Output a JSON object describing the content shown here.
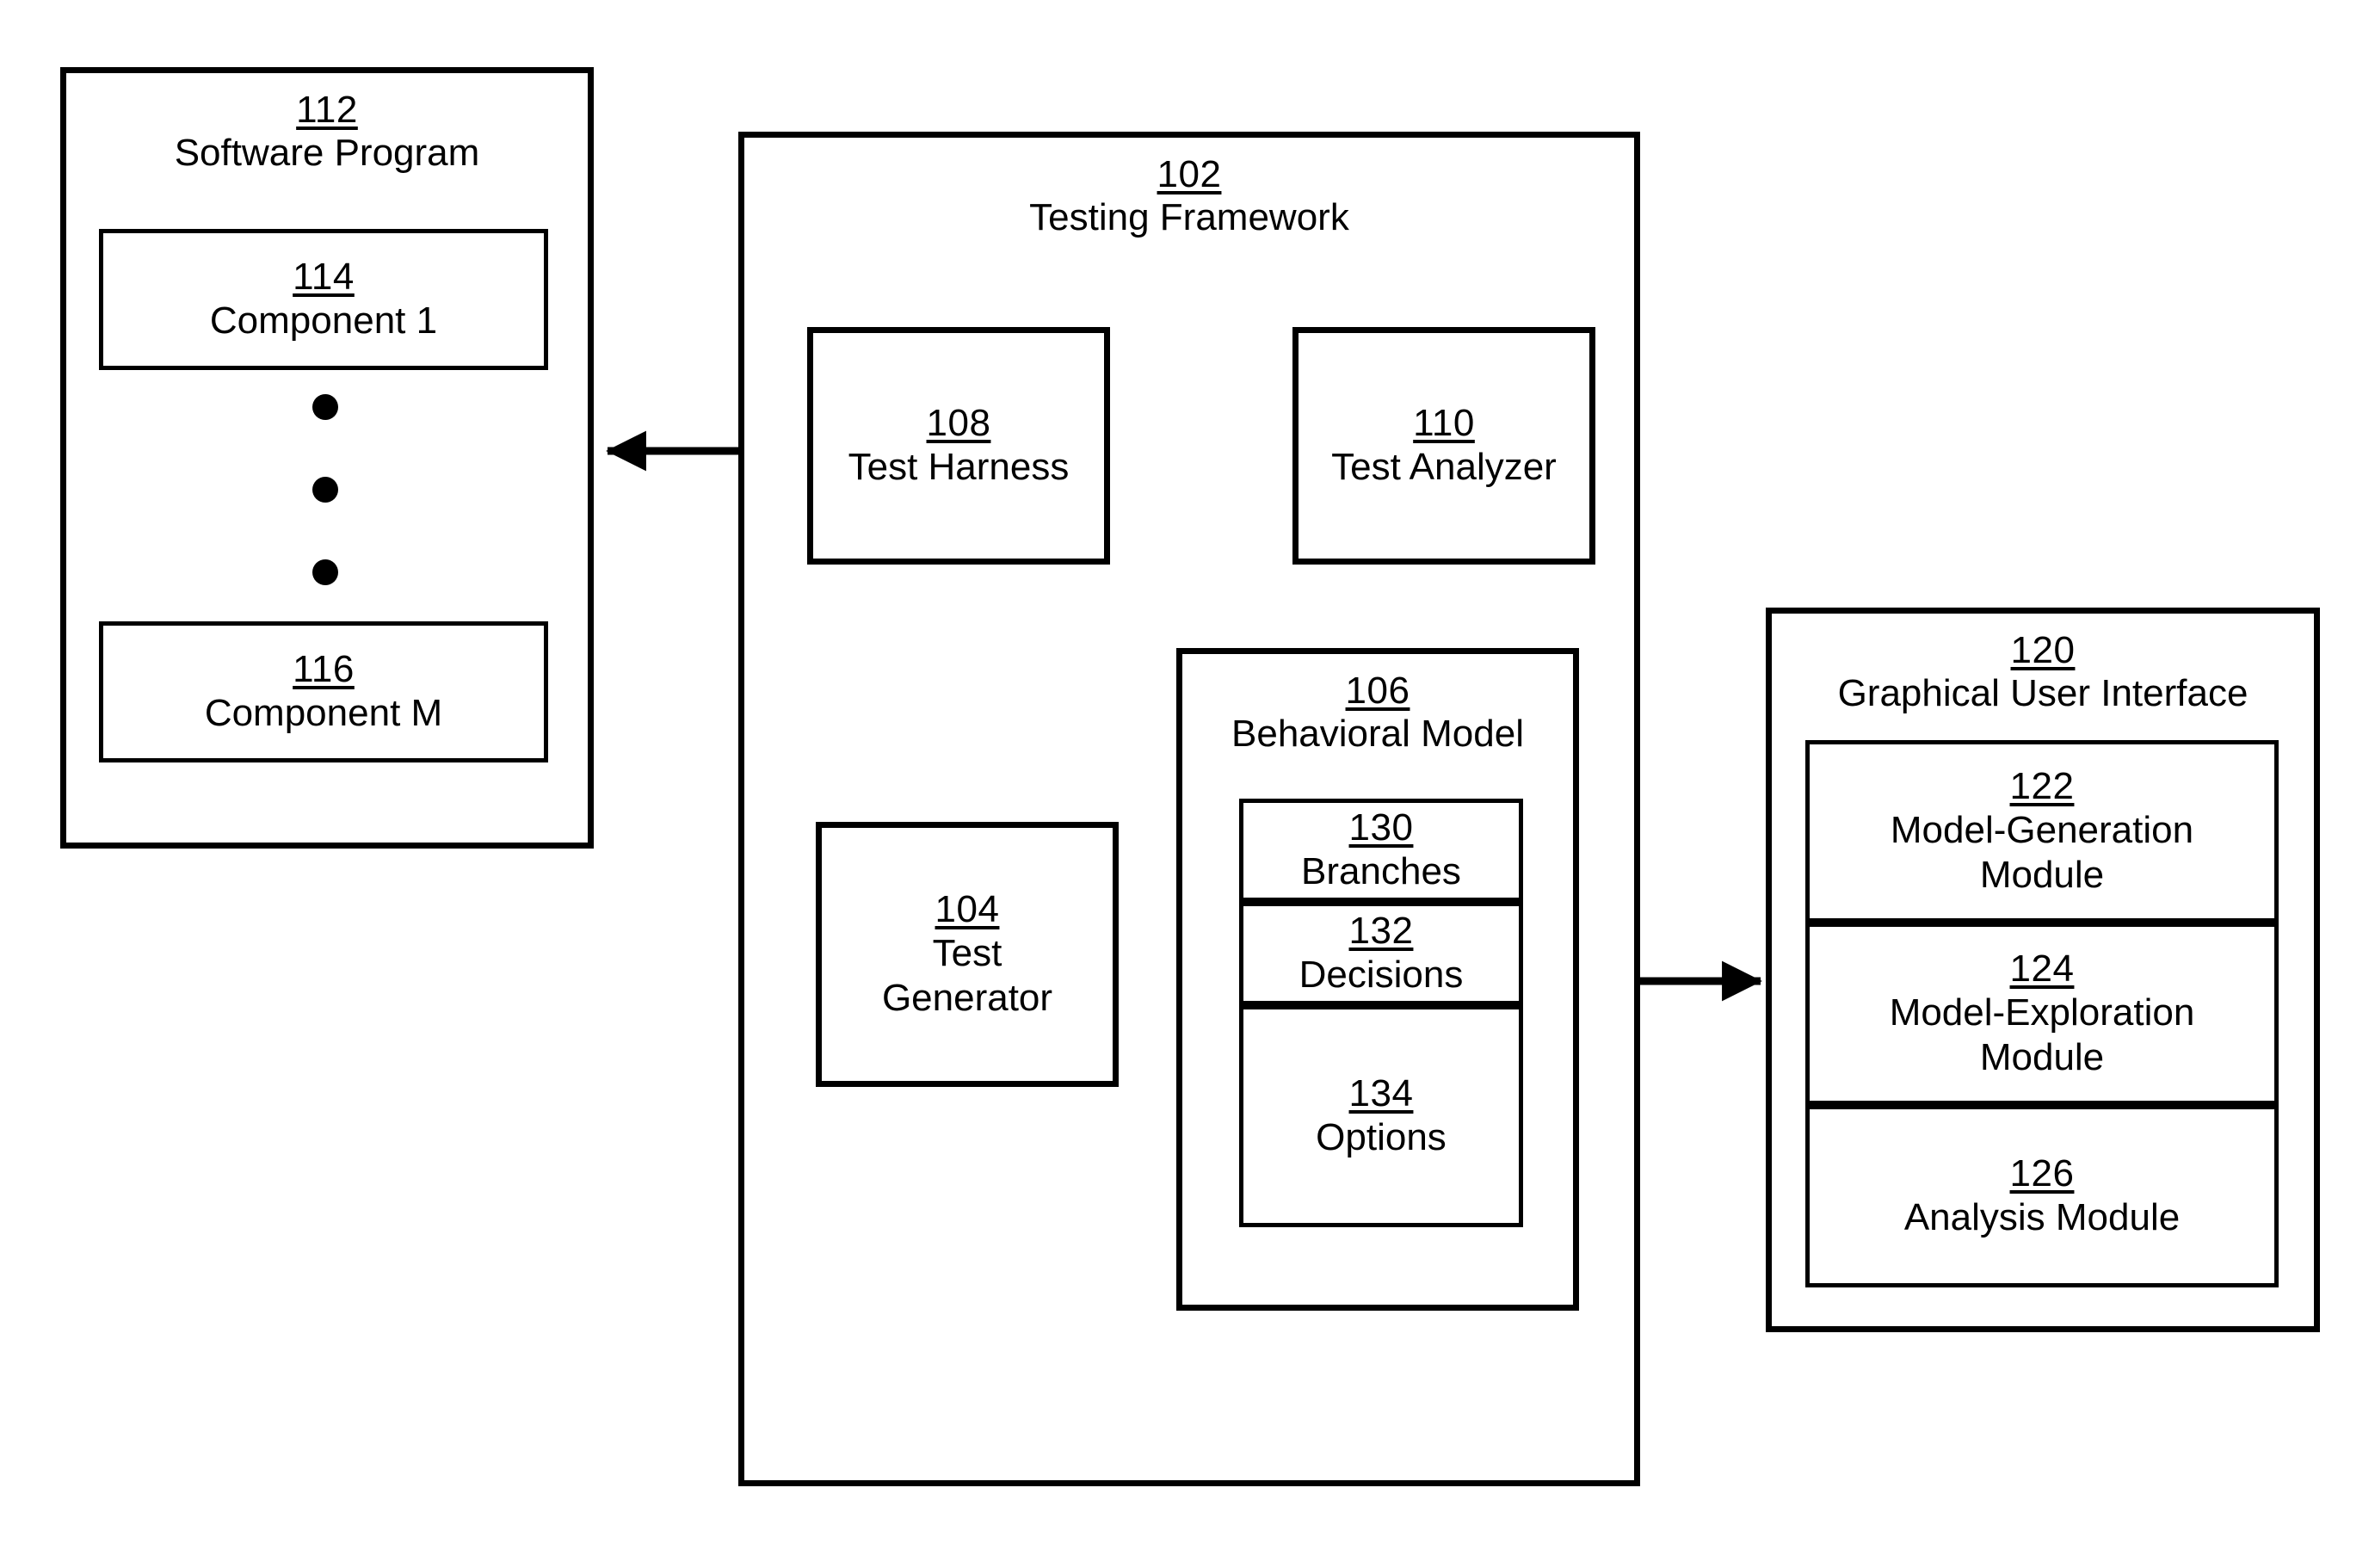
{
  "figure": {
    "kind": "patent-block-diagram",
    "stroke_color": "#000000",
    "background_color": "#ffffff"
  },
  "blocks": {
    "software_program": {
      "ref": "112",
      "label": "Software Program"
    },
    "component_1": {
      "ref": "114",
      "label": "Component 1"
    },
    "component_m": {
      "ref": "116",
      "label": "Component M"
    },
    "testing_framework": {
      "ref": "102",
      "label": "Testing Framework"
    },
    "test_harness": {
      "ref": "108",
      "label": "Test Harness"
    },
    "test_analyzer": {
      "ref": "110",
      "label": "Test Analyzer"
    },
    "test_generator": {
      "ref": "104",
      "label": "Test\nGenerator"
    },
    "behavioral_model": {
      "ref": "106",
      "label": "Behavioral Model"
    },
    "branches": {
      "ref": "130",
      "label": "Branches"
    },
    "decisions": {
      "ref": "132",
      "label": "Decisions"
    },
    "options": {
      "ref": "134",
      "label": "Options"
    },
    "gui": {
      "ref": "120",
      "label": "Graphical User Interface"
    },
    "model_generation": {
      "ref": "122",
      "label": "Model-Generation\nModule"
    },
    "model_exploration": {
      "ref": "124",
      "label": "Model-Exploration\nModule"
    },
    "analysis_module": {
      "ref": "126",
      "label": "Analysis Module"
    }
  },
  "ellipsis": {
    "dot_count": 3
  },
  "connectors": [
    {
      "name": "software-program-to-test-harness",
      "style": "double-arrow",
      "orientation": "horizontal"
    },
    {
      "name": "test-harness-to-test-analyzer",
      "style": "double-arrow",
      "orientation": "horizontal"
    },
    {
      "name": "test-harness-to-test-generator",
      "style": "double-arrow",
      "orientation": "vertical"
    },
    {
      "name": "behavioral-model-to-gui",
      "style": "double-arrow",
      "orientation": "horizontal"
    },
    {
      "name": "test-generator-to-behavioral-model",
      "style": "double-arrow",
      "orientation": "curved"
    }
  ]
}
